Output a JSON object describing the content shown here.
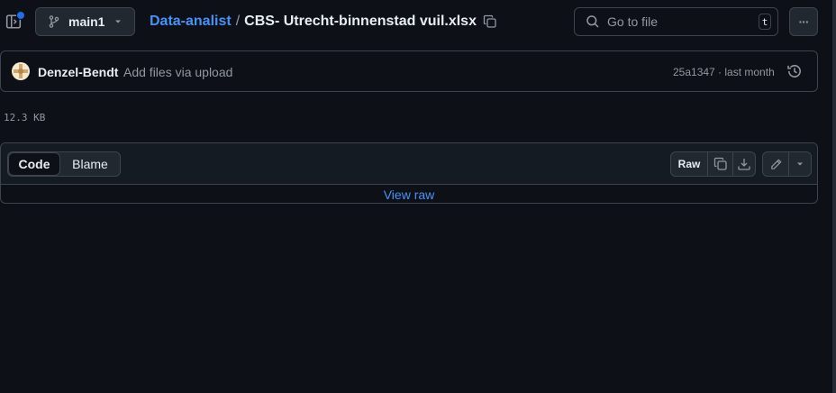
{
  "topbar": {
    "branch": "main1",
    "breadcrumb_repo": "Data-analist",
    "breadcrumb_sep": "/",
    "breadcrumb_file": "CBS- Utrecht-binnenstad vuil.xlsx",
    "search_placeholder": "Go to file",
    "search_shortcut": "t",
    "more_label": "···"
  },
  "commit": {
    "author": "Denzel-Bendt",
    "message": "Add files via upload",
    "hash_time": "25a1347 · last month"
  },
  "file": {
    "size": "12.3 KB"
  },
  "viewer": {
    "tabs": [
      {
        "label": "Code",
        "active": true
      },
      {
        "label": "Blame",
        "active": false
      }
    ],
    "raw_label": "Raw",
    "view_raw_label": "View raw"
  },
  "colors": {
    "background": "#0d1117",
    "accent_link": "#4493f8",
    "border": "#3d444d",
    "notification_dot": "#1f6feb"
  },
  "icons": [
    "sidebar-expand-icon",
    "git-branch-icon",
    "chevron-down-icon",
    "copy-icon",
    "search-icon",
    "history-icon",
    "download-icon",
    "pencil-icon"
  ]
}
